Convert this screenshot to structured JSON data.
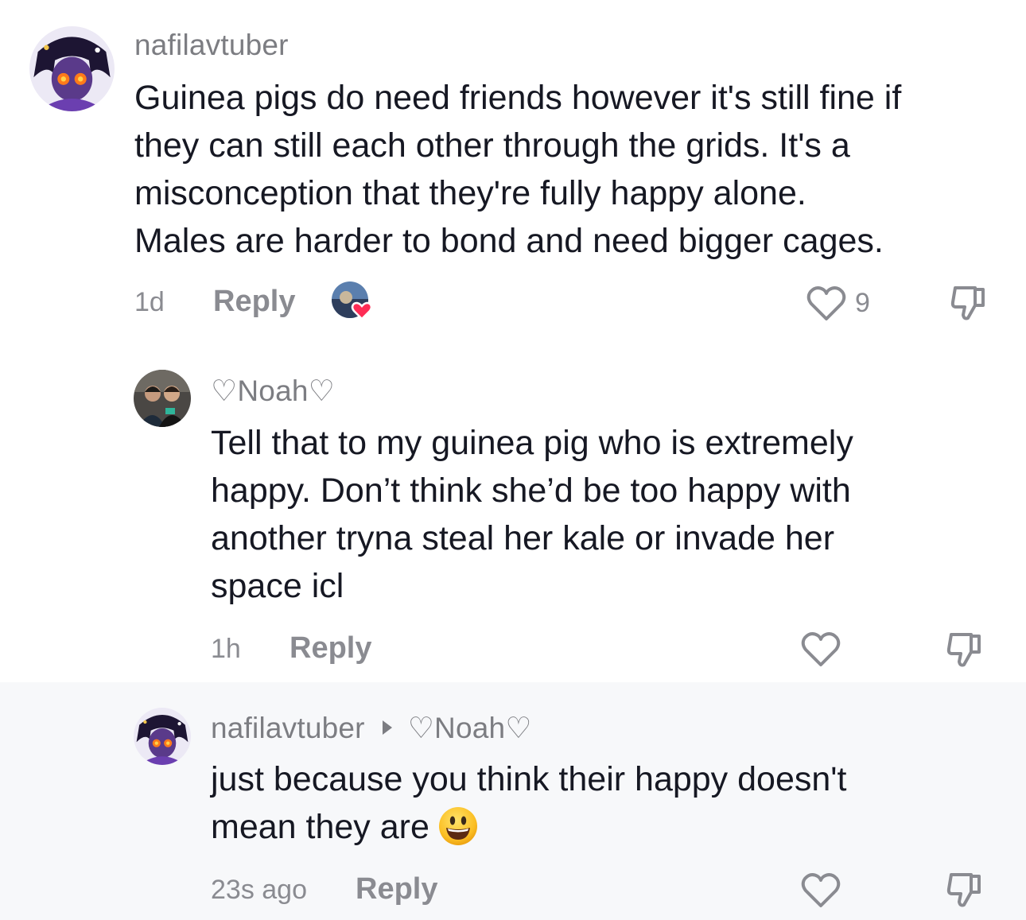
{
  "comments": [
    {
      "username": "nafilavtuber",
      "text": "Guinea pigs do need friends however it's still fine if they can still each other through the grids. It's a misconception that they're fully happy alone. Males are harder to bond and need bigger cages.",
      "text_lines": [
        "Guinea pigs do need friends however it's still fine if",
        "they can still each other through the grids. It's a",
        "misconception that they're fully happy alone.",
        "Males are harder to bond and need bigger cages."
      ],
      "time": "1d",
      "reply_label": "Reply",
      "like_count": "9",
      "liked_by_creator": true
    },
    {
      "username": "♡Noah♡",
      "text_lines": [
        "Tell that to my guinea pig who is extremely",
        "happy. Don’t think she’d be too happy with",
        "another tryna steal her kale or invade her",
        "space icl"
      ],
      "time": "1h",
      "reply_label": "Reply"
    },
    {
      "username": "nafilavtuber",
      "reply_to": "♡Noah♡",
      "text_lines": [
        "just because you think their happy doesn't",
        "mean they are"
      ],
      "emoji": "smiley-emoji",
      "time": "23s ago",
      "reply_label": "Reply"
    }
  ],
  "icons": {
    "like": "heart-outline-icon",
    "dislike": "thumbs-down-icon",
    "creator_like": "creator-heart-badge"
  },
  "colors": {
    "text_primary": "#161823",
    "text_secondary": "#7c7d82",
    "creator_heart": "#fe2c55",
    "highlight_background": "#f7f8fa"
  }
}
